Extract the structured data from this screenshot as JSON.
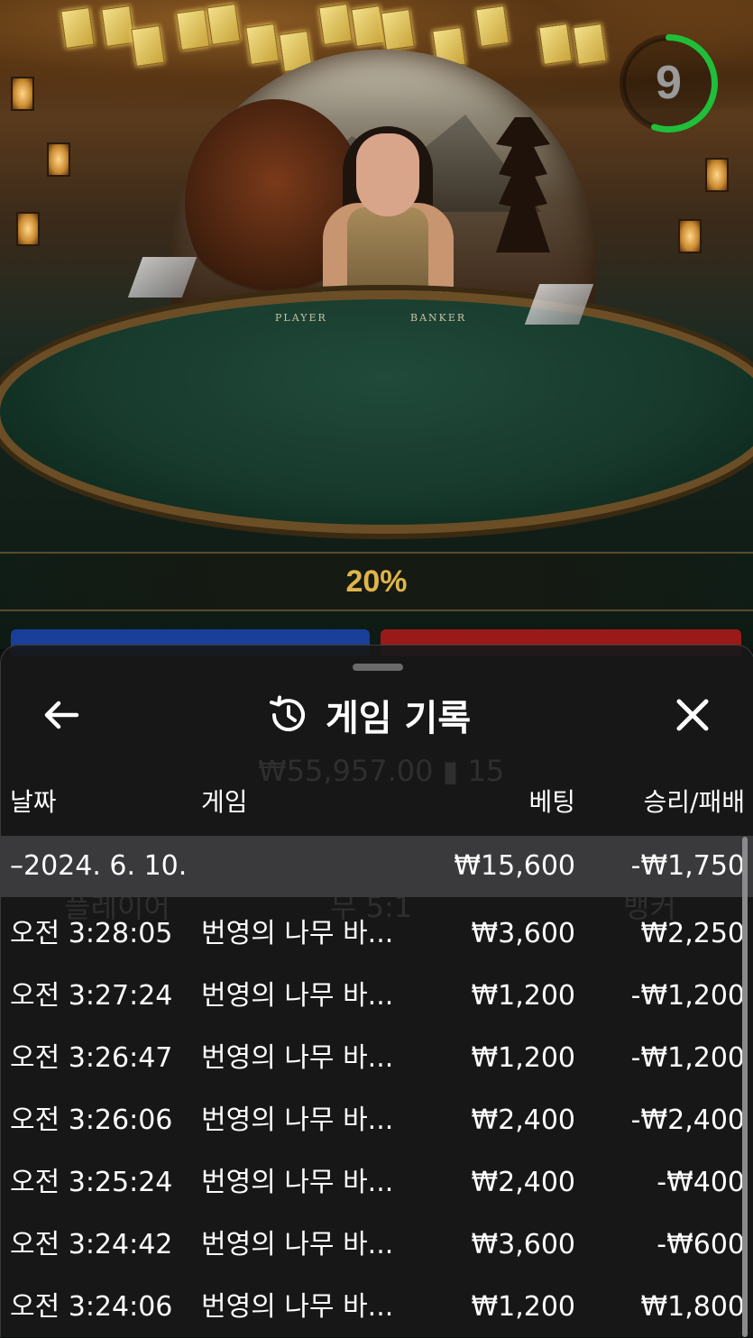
{
  "stream": {
    "table_labels": [
      "PLAYER",
      "BANKER"
    ],
    "timer_value": "9",
    "timer_fraction_remaining": 0.55,
    "payout_label": "20%"
  },
  "colors": {
    "timer_ring": "#1fbf3a",
    "payout_gold": "#e0b44a",
    "player_blue": "#1a3f9a",
    "banker_red": "#9a1a1a"
  },
  "panel": {
    "title": "게임 기록",
    "icons": {
      "back": "arrow-left-icon",
      "history": "history-clock-icon",
      "close": "close-x-icon"
    },
    "columns": {
      "date": "날짜",
      "game": "게임",
      "bet": "베팅",
      "result": "승리/패배"
    },
    "date_group": {
      "date": "–2024. 6. 10.",
      "bet": "₩15,600",
      "result": "-₩1,750"
    },
    "rows": [
      {
        "time": "오전 3:28:05",
        "game": "번영의 나무 바...",
        "bet": "₩3,600",
        "result": "₩2,250"
      },
      {
        "time": "오전 3:27:24",
        "game": "번영의 나무 바...",
        "bet": "₩1,200",
        "result": "-₩1,200"
      },
      {
        "time": "오전 3:26:47",
        "game": "번영의 나무 바...",
        "bet": "₩1,200",
        "result": "-₩1,200"
      },
      {
        "time": "오전 3:26:06",
        "game": "번영의 나무 바...",
        "bet": "₩2,400",
        "result": "-₩2,400"
      },
      {
        "time": "오전 3:25:24",
        "game": "번영의 나무 바...",
        "bet": "₩2,400",
        "result": "-₩400"
      },
      {
        "time": "오전 3:24:42",
        "game": "번영의 나무 바...",
        "bet": "₩3,600",
        "result": "-₩600"
      },
      {
        "time": "오전 3:24:06",
        "game": "번영의 나무 바...",
        "bet": "₩1,200",
        "result": "₩1,800"
      }
    ]
  }
}
